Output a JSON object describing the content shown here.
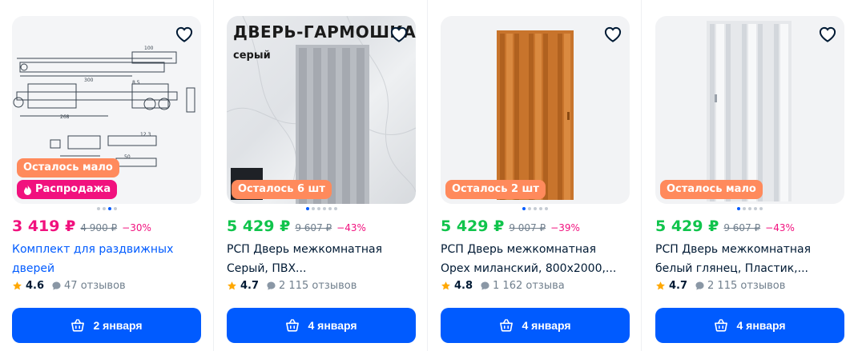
{
  "colors": {
    "accent": "#005bff",
    "price_sale": "#f1117e",
    "price_green": "#10c44c",
    "badge_left": "#ff8a5c",
    "star": "#ffa800"
  },
  "products": [
    {
      "price": "3 419 ₽",
      "old_price": "4 900 ₽",
      "discount": "−30%",
      "title_line1": "Комплект для раздвижных",
      "title_line2": "дверей",
      "rating": "4.6",
      "reviews": "47 отзывов",
      "badge_left": "Осталось мало",
      "badge_sale": "Распродажа",
      "delivery": "2 января",
      "dots_active": 2
    },
    {
      "price": "5 429 ₽",
      "old_price": "9 607 ₽",
      "discount": "−43%",
      "title_line1": "РСП Дверь межкомнатная",
      "title_line2": "Серый, ПВХ...",
      "rating": "4.7",
      "reviews": "2 115 отзывов",
      "badge_left": "Осталось 6 шт",
      "image_text_big": "ДВЕРЬ-ГАРМОШКА",
      "image_text_small": "серый",
      "delivery": "4 января",
      "dots_active": 0
    },
    {
      "price": "5 429 ₽",
      "old_price": "9 007 ₽",
      "discount": "−39%",
      "title_line1": "РСП Дверь межкомнатная",
      "title_line2": "Орех миланский, 800x2000,...",
      "rating": "4.8",
      "reviews": "1 162 отзыва",
      "badge_left": "Осталось 2 шт",
      "delivery": "4 января",
      "dots_active": 0
    },
    {
      "price": "5 429 ₽",
      "old_price": "9 607 ₽",
      "discount": "−43%",
      "title_line1": "РСП Дверь межкомнатная",
      "title_line2": "белый глянец, Пластик,...",
      "rating": "4.7",
      "reviews": "2 115 отзывов",
      "badge_left": "Осталось мало",
      "delivery": "4 января",
      "dots_active": 0
    }
  ]
}
